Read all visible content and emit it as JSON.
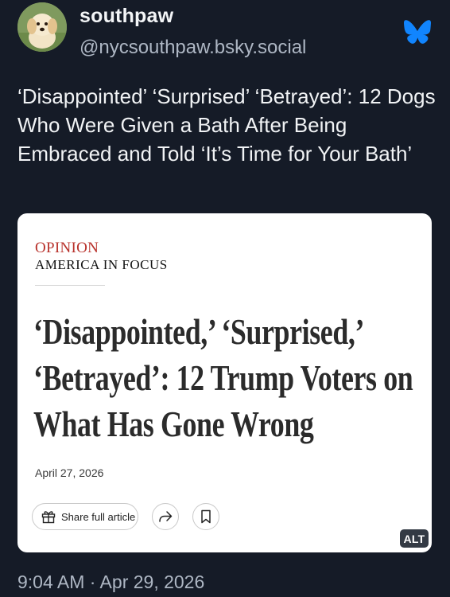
{
  "author": {
    "display_name": "southpaw",
    "handle": "@nycsouthpaw.bsky.social",
    "avatar": "puppy-avatar"
  },
  "post": {
    "text": "‘Disappointed’ ‘Surprised’ ‘Betrayed’: 12 Dogs Who Were Given a Bath After Being Embraced and Told ‘It’s Time for Your Bath’",
    "timestamp": "9:04 AM · Apr 29, 2026"
  },
  "embed": {
    "kicker": "OPINION",
    "section": "AMERICA IN FOCUS",
    "headline": "‘Disappointed,’ ‘Surprised,’ ‘Betrayed’: 12 Trump Voters on What Has Gone Wrong",
    "date": "April 27, 2026",
    "share_label": "Share full article",
    "alt_label": "ALT"
  },
  "icons": {
    "app": "butterfly-icon",
    "share": "gift-icon",
    "forward": "forward-arrow-icon",
    "bookmark": "bookmark-icon"
  },
  "colors": {
    "background": "#151b27",
    "bluesky_blue": "#1185fe",
    "kicker_red": "#b8312b",
    "handle_gray": "#aeb7c4"
  }
}
